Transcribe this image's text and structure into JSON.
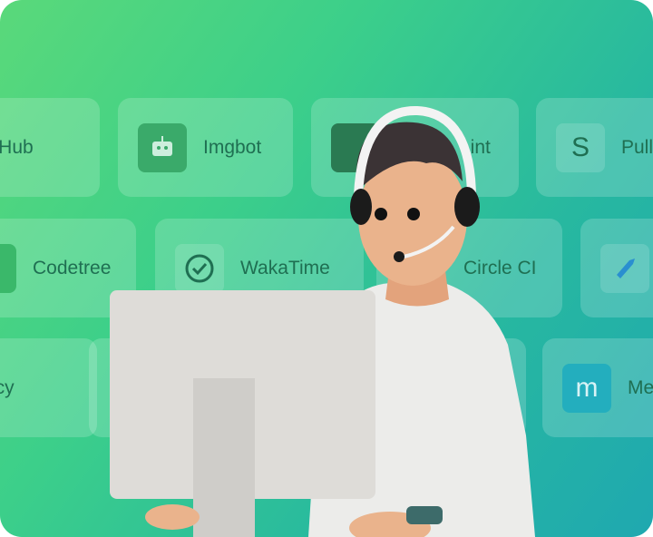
{
  "integrations": [
    {
      "label": "ZenHub",
      "icon": "zenhub-icon"
    },
    {
      "label": "Imgbot",
      "icon": "robot-icon"
    },
    {
      "label": "Lint",
      "icon": "lint-icon"
    },
    {
      "label": "Pull",
      "icon": "pull-icon"
    },
    {
      "label": "Codetree",
      "icon": "codetree-icon"
    },
    {
      "label": "WakaTime",
      "icon": "wakatime-icon"
    },
    {
      "label": "Circle CI",
      "icon": "circleci-icon"
    },
    {
      "label": "",
      "icon": "azure-pipelines-icon"
    },
    {
      "label": "Percy",
      "icon": "percy-icon"
    },
    {
      "label": "Me",
      "icon": "mergify-icon"
    }
  ],
  "colors": {
    "gradient_start": "#5ad97a",
    "gradient_end": "#1fa8b0",
    "label": "#1f6f52"
  }
}
